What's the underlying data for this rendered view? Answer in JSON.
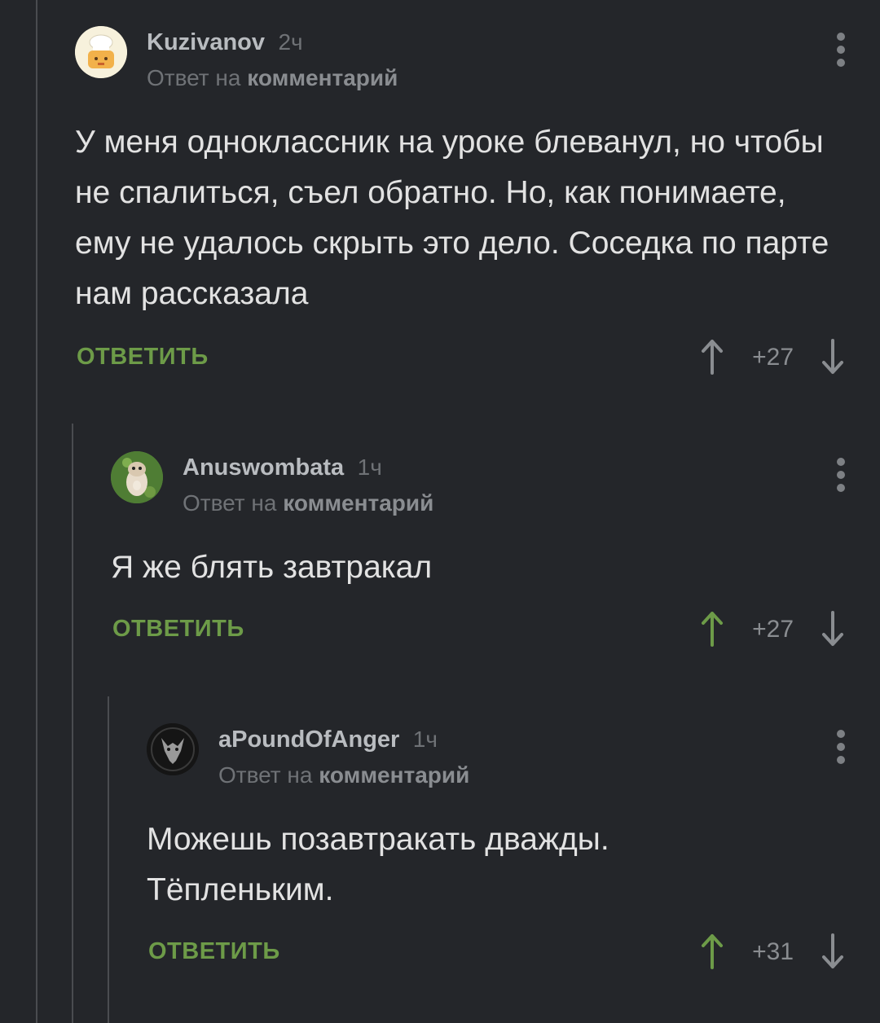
{
  "comments": [
    {
      "author": "Kuzivanov",
      "time": "2ч",
      "reply_prefix": "Ответ на",
      "reply_target": "комментарий",
      "text": "У меня одноклассник на уроке блеванул, но чтобы не спалиться, съел обратно. Но, как понимаете, ему не удалось скрыть это дело. Соседка по парте нам рассказала",
      "reply_label": "ОТВЕТИТЬ",
      "score": "+27",
      "upvoted": false
    },
    {
      "author": "Anuswombata",
      "time": "1ч",
      "reply_prefix": "Ответ на",
      "reply_target": "комментарий",
      "text": "Я же блять завтракал",
      "reply_label": "ОТВЕТИТЬ",
      "score": "+27",
      "upvoted": true
    },
    {
      "author": "aPoundOfAnger",
      "time": "1ч",
      "reply_prefix": "Ответ на",
      "reply_target": "комментарий",
      "text": "Можешь позавтракать дважды. Тёпленьким.",
      "reply_label": "ОТВЕТИТЬ",
      "score": "+31",
      "upvoted": true
    }
  ],
  "colors": {
    "background": "#24262a",
    "accent_green": "#6d9b48",
    "muted": "#6f7276",
    "text": "#e2e2e2"
  },
  "icons": {
    "menu": "vertical-dots-icon",
    "upvote": "arrow-up-icon",
    "downvote": "arrow-down-icon"
  }
}
